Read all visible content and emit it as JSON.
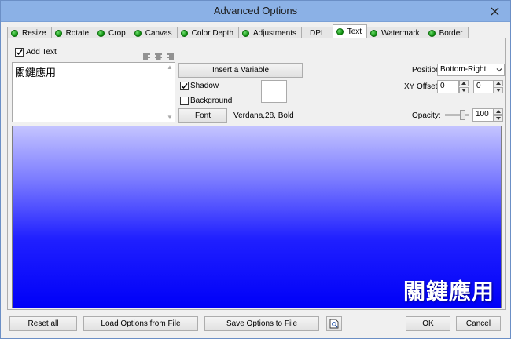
{
  "window": {
    "title": "Advanced Options"
  },
  "tabs": [
    {
      "label": "Resize"
    },
    {
      "label": "Rotate"
    },
    {
      "label": "Crop"
    },
    {
      "label": "Canvas"
    },
    {
      "label": "Color Depth"
    },
    {
      "label": "Adjustments"
    },
    {
      "label": "DPI"
    },
    {
      "label": "Text"
    },
    {
      "label": "Watermark"
    },
    {
      "label": "Border"
    }
  ],
  "text_panel": {
    "add_text_label": "Add Text",
    "add_text_checked": true,
    "text_content": "關鍵應用",
    "insert_variable_label": "Insert a Variable",
    "shadow_label": "Shadow",
    "shadow_checked": true,
    "background_label": "Background",
    "background_checked": false,
    "font_button_label": "Font",
    "font_info": "Verdana,28, Bold",
    "position_label": "Position:",
    "position_value": "Bottom-Right",
    "xy_offset_label": "XY Offset",
    "x_offset_value": "0",
    "y_offset_value": "0",
    "opacity_label": "Opacity:",
    "opacity_value": "100"
  },
  "preview": {
    "overlay_text": "關鍵應用"
  },
  "footer": {
    "reset_label": "Reset all",
    "load_label": "Load Options from File",
    "save_label": "Save Options to File",
    "ok_label": "OK",
    "cancel_label": "Cancel"
  },
  "colors": {
    "status_dot": "#1aa51a",
    "preview_top": "#c4c4ff",
    "preview_bottom": "#0000f8"
  }
}
